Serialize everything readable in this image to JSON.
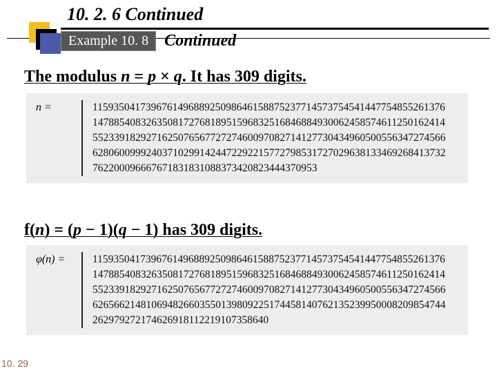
{
  "header": {
    "section": "10. 2. 6  Continued",
    "example_label": "Example 10. 8",
    "example_cont": "Continued"
  },
  "statements": {
    "s1_pre": "The modulus ",
    "s1_var1": "n",
    "s1_mid1": " = ",
    "s1_var2": "p",
    "s1_mid2": " × ",
    "s1_var3": "q",
    "s1_post": ". It has 309 digits.",
    "s2_sym": "f",
    "s2_lp": "(",
    "s2_n": "n",
    "s2_rp": ") = (",
    "s2_p": "p",
    "s2_m1": " − 1)(",
    "s2_q": "q",
    "s2_post": " − 1) has 309 digits."
  },
  "block1": {
    "label": "n =",
    "value": "115935041739676149688925098646158875237714573754541447754855261376147885408326350817276818951596832516846884930062458574611250162414552339182927162507656772727460097082714127730434960500556347274566628060099924037102991424472292215772798531727029638133469268413732762200096667671831831088373420823444370953"
  },
  "block2": {
    "label": "φ(n) =",
    "value": "115935041739676149688925098646158875237714573754541447754855261376147885408326350817276818951596832516846884930062458574611250162414552339182927162507656772727460097082714127730434960500556347274566626566214810694826603550139809225174458140762135239950008209854744262979272174626918112219107358640"
  },
  "pagenum": "10. 29"
}
